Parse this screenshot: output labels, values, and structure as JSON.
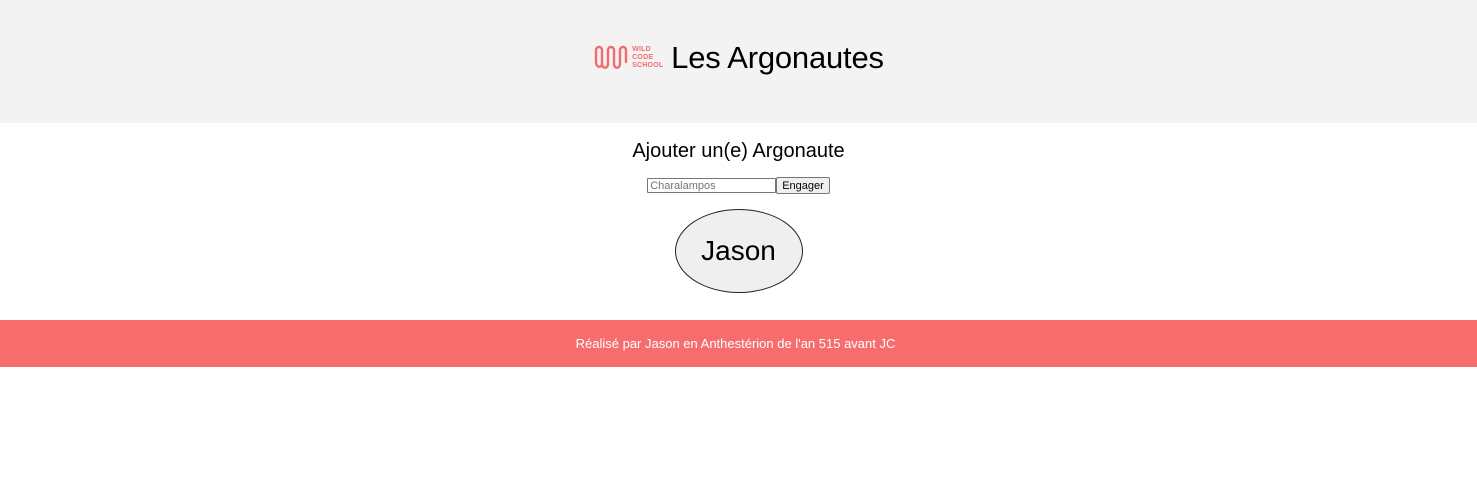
{
  "header": {
    "logo": {
      "lines": [
        "WILD",
        "CODE",
        "SCHOOL"
      ],
      "icon": "wild-code-school-logo"
    },
    "title": "Les Argonautes"
  },
  "main": {
    "section_title": "Ajouter un(e) Argonaute",
    "form": {
      "input_placeholder": "Charalampos",
      "input_value": "",
      "submit_label": "Engager"
    },
    "members": [
      "Jason"
    ]
  },
  "footer": {
    "text": "Réalisé par Jason en Anthestérion de l'an 515 avant JC"
  },
  "colors": {
    "header_bg": "#f3f3f3",
    "footer_bg": "#f76d6e",
    "brand": "#f56b6d"
  }
}
